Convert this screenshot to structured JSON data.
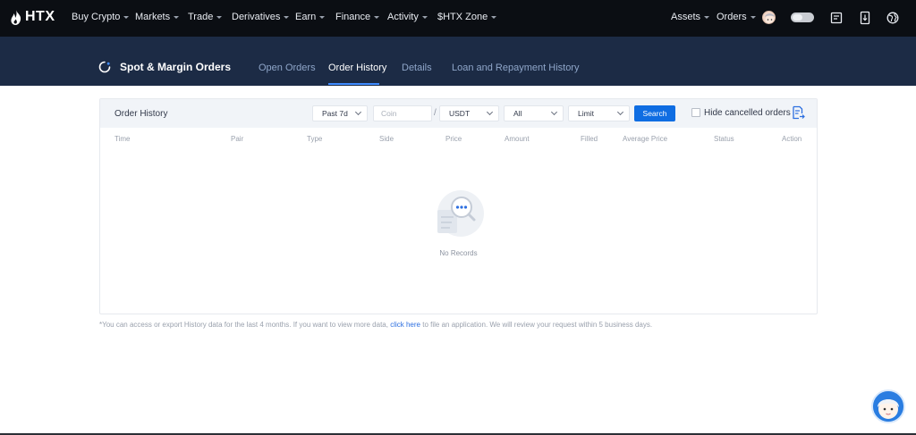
{
  "brand": {
    "logo_text": "HTX"
  },
  "topnav": {
    "items": [
      {
        "label": "Buy Crypto"
      },
      {
        "label": "Markets"
      },
      {
        "label": "Trade"
      },
      {
        "label": "Derivatives"
      },
      {
        "label": "Earn"
      },
      {
        "label": "Finance"
      },
      {
        "label": "Activity"
      },
      {
        "label": "$HTX Zone"
      }
    ],
    "right": {
      "assets": "Assets",
      "orders": "Orders",
      "icons": [
        "avatar-icon",
        "toggle-icon",
        "notes-icon",
        "download-icon",
        "globe-icon"
      ]
    }
  },
  "subheader": {
    "title": "Spot & Margin Orders",
    "tabs": [
      {
        "label": "Open Orders",
        "active": false
      },
      {
        "label": "Order History",
        "active": true
      },
      {
        "label": "Details",
        "active": false
      },
      {
        "label": "Loan and Repayment History",
        "active": false
      }
    ]
  },
  "card": {
    "title": "Order History",
    "filters": {
      "period": "Past 7d",
      "coin_placeholder": "Coin",
      "separator": "/",
      "quote": "USDT",
      "side": "All",
      "type": "Limit",
      "search_label": "Search",
      "hide_cancelled_label": "Hide cancelled orders",
      "hide_cancelled_checked": false
    },
    "columns": [
      "Time",
      "Pair",
      "Type",
      "Side",
      "Price",
      "Amount",
      "Filled",
      "Average Price",
      "Status",
      "Action"
    ],
    "rows": [],
    "empty_text": "No Records"
  },
  "footnote": {
    "before": "*You can access or export History data for the last 4 months. If you want to view more data, ",
    "link": "click here",
    "after": " to file an application. We will review your request within 5 business days."
  },
  "colors": {
    "nav_bg": "#0b0e13",
    "subheader_bg": "#1c2b45",
    "accent": "#0f6de2",
    "tab_underline": "#3f8cff"
  }
}
